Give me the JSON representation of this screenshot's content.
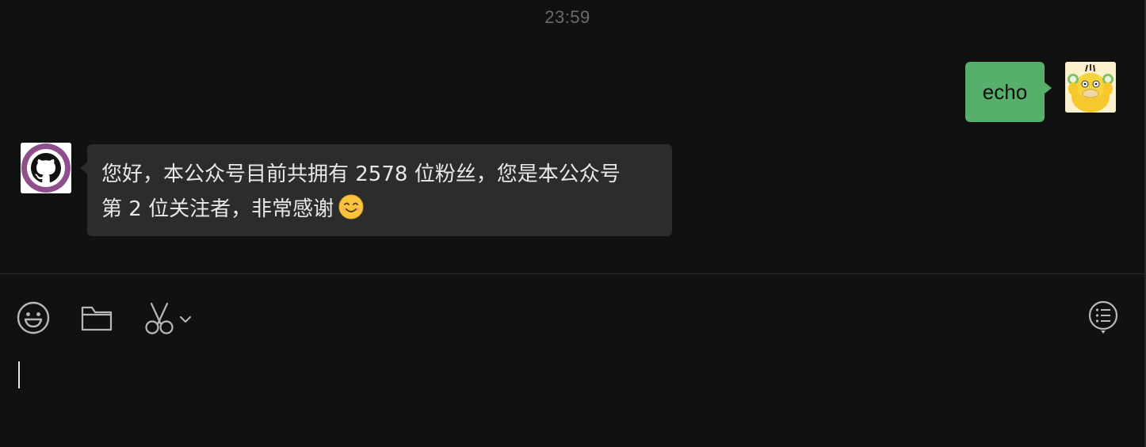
{
  "chat": {
    "timestamp": "23:59",
    "messages": [
      {
        "sender": "self",
        "avatar_icon": "psyduck-avatar-icon",
        "text": "echo"
      },
      {
        "sender": "official-account",
        "avatar_icon": "github-octocat-avatar-icon",
        "line1": "您好，本公众号目前共拥有 2578 位粉丝，您是本公众号",
        "line2": "第 2 位关注者，非常感谢",
        "emoji": "smiling-face-emoji-icon"
      }
    ]
  },
  "toolbar": {
    "icons": [
      "emoji-icon",
      "folder-icon",
      "scissors-icon",
      "chevron-down-icon",
      "chat-history-icon"
    ]
  },
  "input": {
    "value": ""
  },
  "colors": {
    "background": "#111111",
    "self_bubble": "#56b06b",
    "other_bubble": "#2c2c2c",
    "avatar_ring": "#8e4f8c"
  }
}
